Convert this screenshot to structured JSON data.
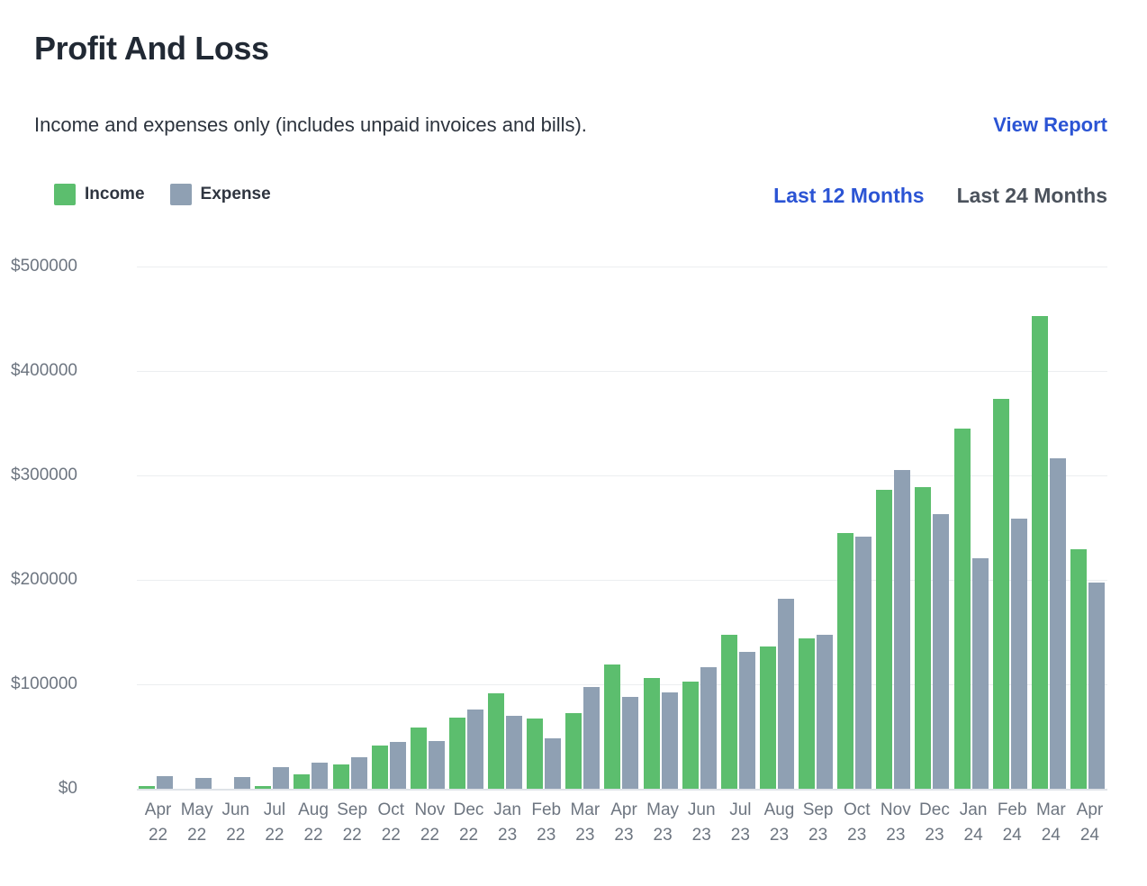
{
  "header": {
    "title": "Profit And Loss",
    "subtitle": "Income and expenses only (includes unpaid invoices and bills).",
    "view_report_label": "View Report"
  },
  "legend": [
    {
      "label": "Income",
      "color": "#5cbe6e",
      "swatch_name": "income-swatch"
    },
    {
      "label": "Expense",
      "color": "#8fa0b3",
      "swatch_name": "expense-swatch"
    }
  ],
  "ranges": [
    {
      "label": "Last 12 Months",
      "active": true
    },
    {
      "label": "Last 24 Months",
      "active": false
    }
  ],
  "colors": {
    "income": "#5cbe6e",
    "expense": "#8fa0b3",
    "link": "#2b54d4",
    "inactive_text": "#4b525c",
    "axis_text": "#6d7580",
    "gridline": "#eceef0",
    "title": "#212934"
  },
  "chart_data": {
    "type": "bar",
    "title": "Profit And Loss",
    "subtitle": "Income and expenses only (includes unpaid invoices and bills).",
    "xlabel": "",
    "ylabel": "",
    "ylim": [
      0,
      500000
    ],
    "yticks": [
      0,
      100000,
      200000,
      300000,
      400000,
      500000
    ],
    "ytick_labels": [
      "$0",
      "$100000",
      "$200000",
      "$300000",
      "$400000",
      "$500000"
    ],
    "grid": true,
    "legend_position": "top-left",
    "categories": [
      "Apr 22",
      "May 22",
      "Jun 22",
      "Jul 22",
      "Aug 22",
      "Sep 22",
      "Oct 22",
      "Nov 22",
      "Dec 22",
      "Jan 23",
      "Feb 23",
      "Mar 23",
      "Apr 23",
      "May 23",
      "Jun 23",
      "Jul 23",
      "Aug 23",
      "Sep 23",
      "Oct 23",
      "Nov 23",
      "Dec 23",
      "Jan 24",
      "Feb 24",
      "Mar 24",
      "Apr 24"
    ],
    "category_months": [
      "Apr",
      "May",
      "Jun",
      "Jul",
      "Aug",
      "Sep",
      "Oct",
      "Nov",
      "Dec",
      "Jan",
      "Feb",
      "Mar",
      "Apr",
      "May",
      "Jun",
      "Jul",
      "Aug",
      "Sep",
      "Oct",
      "Nov",
      "Dec",
      "Jan",
      "Feb",
      "Mar",
      "Apr"
    ],
    "category_years": [
      "22",
      "22",
      "22",
      "22",
      "22",
      "22",
      "22",
      "22",
      "22",
      "23",
      "23",
      "23",
      "23",
      "23",
      "23",
      "23",
      "23",
      "23",
      "23",
      "23",
      "23",
      "24",
      "24",
      "24",
      "24"
    ],
    "series": [
      {
        "name": "Income",
        "color": "#5cbe6e",
        "values": [
          3000,
          0,
          0,
          2500,
          14000,
          23000,
          41000,
          59000,
          68000,
          91000,
          67000,
          72000,
          119000,
          106000,
          103000,
          147000,
          136000,
          144000,
          245000,
          286000,
          289000,
          345000,
          373000,
          453000,
          229000
        ]
      },
      {
        "name": "Expense",
        "color": "#8fa0b3",
        "values": [
          12000,
          10000,
          11000,
          21000,
          25000,
          30000,
          45000,
          46000,
          76000,
          70000,
          48000,
          97000,
          88000,
          92000,
          116000,
          131000,
          182000,
          147000,
          241000,
          305000,
          263000,
          221000,
          259000,
          316000,
          197000
        ]
      }
    ]
  }
}
